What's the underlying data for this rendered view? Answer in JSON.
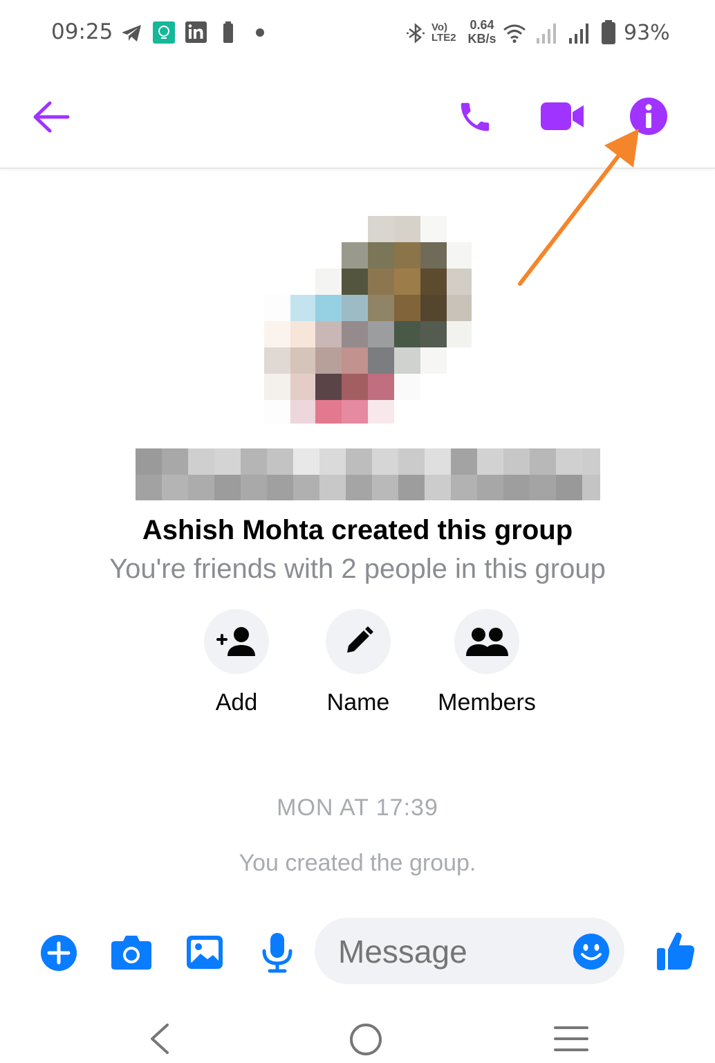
{
  "status_bar": {
    "time": "09:25",
    "notification_icons": [
      "telegram-icon",
      "notification-app-icon",
      "linkedin-icon",
      "battery-alert-icon",
      "dot-icon"
    ],
    "bluetooth_icon": "bluetooth-icon",
    "lte_label_top": "Vo)",
    "lte_label_bottom": "LTE2",
    "net_speed_value": "0.64",
    "net_speed_unit": "KB/s",
    "battery_percent": "93%"
  },
  "top_bar": {
    "back_icon": "arrow-left-icon",
    "call_icon": "phone-icon",
    "video_icon": "video-camera-icon",
    "info_icon": "info-icon",
    "accent_color": "#a033ff",
    "annotation_arrow_color": "#f5852a"
  },
  "group_header": {
    "creator_line": "Ashish Mohta created this group",
    "friends_line": "You're friends with 2 people in this group"
  },
  "actions": [
    {
      "label": "Add",
      "icon": "add-person-icon"
    },
    {
      "label": "Name",
      "icon": "pencil-icon"
    },
    {
      "label": "Members",
      "icon": "people-icon"
    }
  ],
  "conversation": {
    "timestamp": "MON AT 17:39",
    "system_message": "You created the group."
  },
  "composer": {
    "placeholder": "Message",
    "icons": [
      "plus-circle-icon",
      "camera-icon",
      "image-icon",
      "microphone-icon",
      "emoji-icon",
      "thumbs-up-icon"
    ],
    "accent_color": "#0a7cff"
  },
  "nav_bar": {
    "icons": [
      "back-nav-icon",
      "home-nav-icon",
      "recents-nav-icon"
    ]
  }
}
